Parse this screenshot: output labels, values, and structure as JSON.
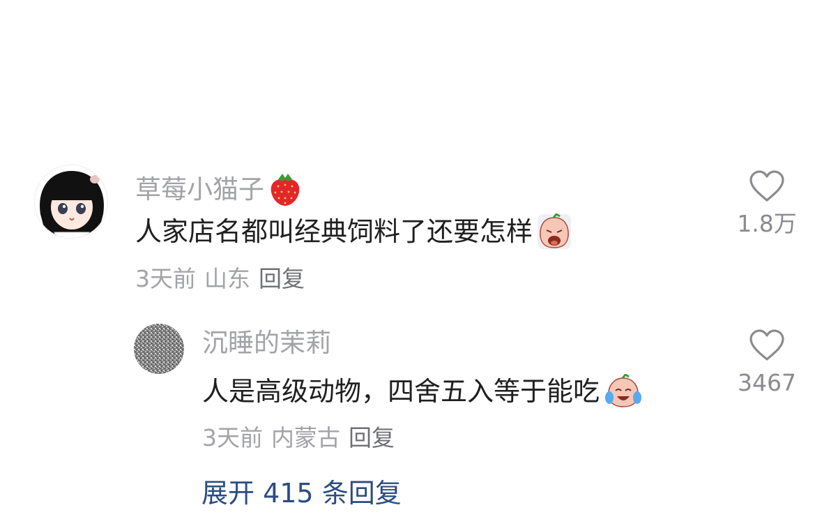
{
  "comments": [
    {
      "username": "草莓小猫子",
      "username_emoji": "strawberry-icon",
      "text": "人家店名都叫经典饲料了还要怎样",
      "text_emoji": "crying-face-icon",
      "time": "3天前",
      "location": "山东",
      "reply_label": "回复",
      "likes": "1.8万"
    },
    {
      "username": "沉睡的茉莉",
      "text": "人是高级动物，四舍五入等于能吃",
      "text_emoji": "laughing-tears-icon",
      "time": "3天前",
      "location": "内蒙古",
      "reply_label": "回复",
      "likes": "3467"
    }
  ],
  "expand_replies": {
    "label": "展开 415 条回复"
  },
  "colors": {
    "text": "#1f1f1f",
    "muted": "#a2a3a6",
    "link": "#2b4c80",
    "background": "#ffffff"
  }
}
